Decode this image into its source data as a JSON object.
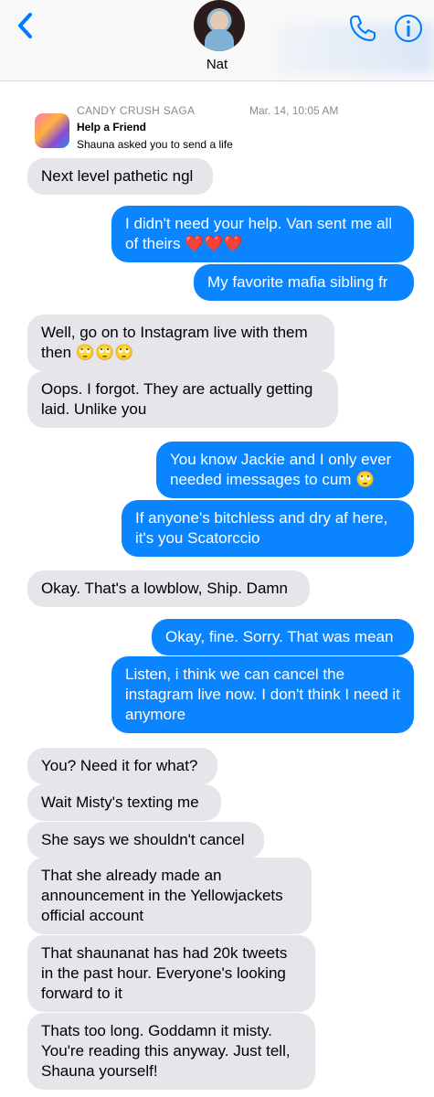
{
  "header": {
    "contact_name": "Nat"
  },
  "system_message": {
    "app_name": "CANDY CRUSH SAGA",
    "timestamp": "Mar. 14, 10:05 AM",
    "title": "Help a Friend",
    "subtitle": "Shauna asked you to send a life"
  },
  "messages": [
    {
      "side": "received",
      "text": "Next level pathetic ngl"
    },
    {
      "side": "sent",
      "text": "I didn't need your help. Van sent me all of theirs ❤️❤️❤️"
    },
    {
      "side": "sent",
      "text": "My favorite mafia sibling fr"
    },
    {
      "side": "received",
      "text": "Well, go on to Instagram live with them then 🙄🙄🙄"
    },
    {
      "side": "received",
      "text": "Oops. I forgot. They are actually getting laid. Unlike you"
    },
    {
      "side": "sent",
      "text": "You know Jackie and I only ever needed imessages to cum 🙄"
    },
    {
      "side": "sent",
      "text": "If anyone's bitchless and dry af here, it's you Scatorccio"
    },
    {
      "side": "received",
      "text": "Okay. That's a lowblow, Ship. Damn"
    },
    {
      "side": "sent",
      "text": "Okay, fine. Sorry. That was mean"
    },
    {
      "side": "sent",
      "text": "Listen, i think we can cancel the instagram live now. I don't think I need it anymore"
    },
    {
      "side": "received",
      "text": "You? Need it for what?"
    },
    {
      "side": "received",
      "text": "Wait Misty's texting me"
    },
    {
      "side": "received",
      "text": "She says we shouldn't cancel"
    },
    {
      "side": "received",
      "text": "That she already made an announcement in the Yellowjackets official account"
    },
    {
      "side": "received",
      "text": "That shaunanat has had 20k tweets in the past hour. Everyone's looking forward to it"
    },
    {
      "side": "received",
      "text": "Thats too long. Goddamn it misty. You're reading this anyway. Just tell, Shauna yourself!"
    }
  ],
  "icons": {
    "back": "chevron-left-icon",
    "call": "phone-icon",
    "info": "info-icon",
    "app": "candy-crush-app-icon"
  },
  "colors": {
    "sent_bubble": "#0a84ff",
    "received_bubble": "#e5e5ea",
    "accent": "#007aff"
  }
}
